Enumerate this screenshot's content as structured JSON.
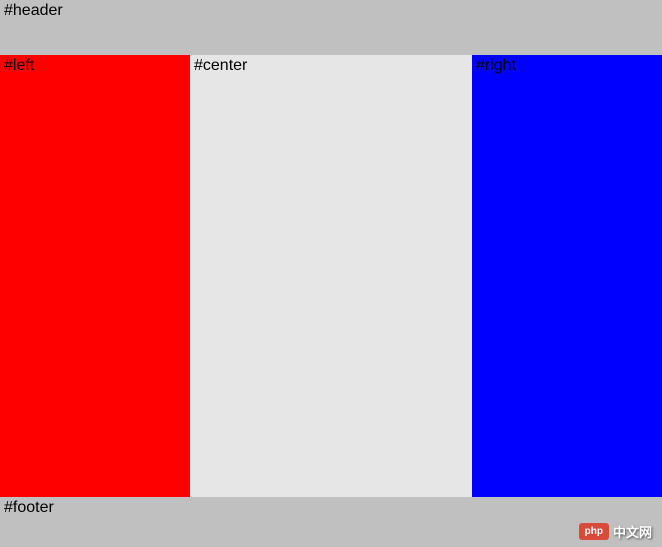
{
  "header": {
    "label": "#header"
  },
  "left": {
    "label": "#left",
    "color": "#ff0000"
  },
  "center": {
    "label": "#center",
    "color": "#e6e6e6"
  },
  "right": {
    "label": "#right",
    "color": "#0000ff"
  },
  "footer": {
    "label": "#footer"
  },
  "watermark": {
    "badge": "php",
    "text": "中文网"
  }
}
